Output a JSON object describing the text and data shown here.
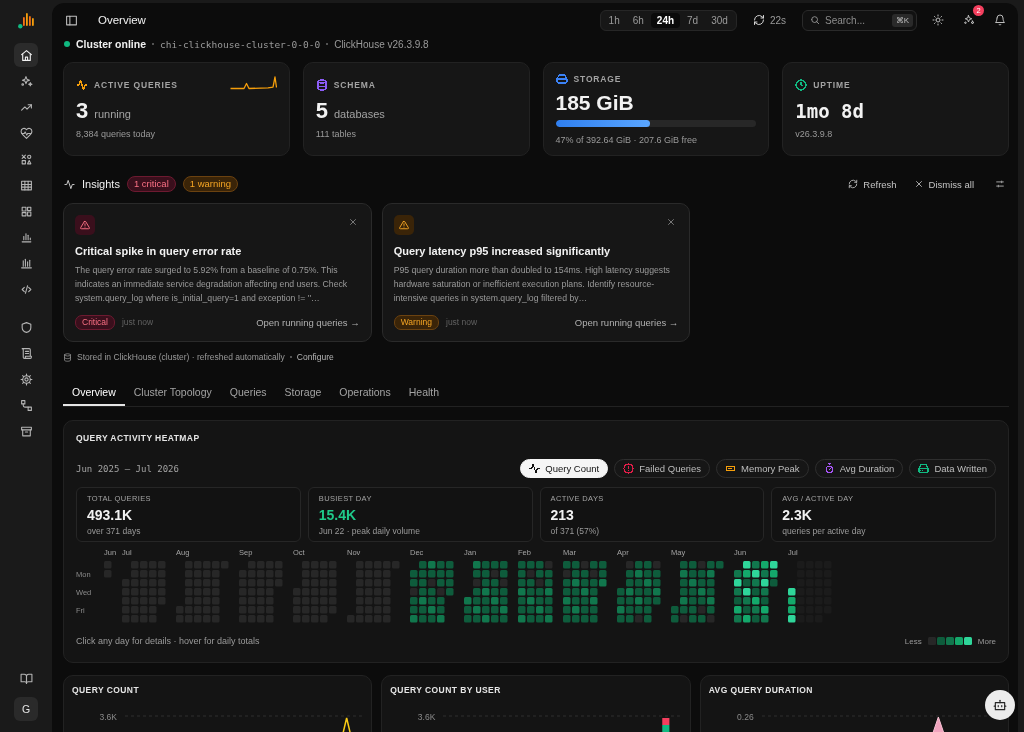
{
  "sidebar": {
    "primary": [
      {
        "selected": true
      },
      {
        "selected": false
      },
      {
        "selected": false
      },
      {
        "selected": false
      },
      {
        "selected": false
      },
      {
        "selected": false
      },
      {
        "selected": false
      },
      {
        "selected": false
      },
      {
        "selected": false
      },
      {
        "selected": false
      }
    ],
    "secondary": [
      {
        "selected": false
      },
      {
        "selected": false
      },
      {
        "selected": false
      },
      {
        "selected": false
      },
      {
        "selected": false
      }
    ],
    "footer": [
      {
        "selected": false
      }
    ],
    "avatar": "G"
  },
  "header": {
    "title": "Overview",
    "time_ranges": [
      {
        "label": "1h",
        "selected": false
      },
      {
        "label": "6h",
        "selected": false
      },
      {
        "label": "24h",
        "selected": true
      },
      {
        "label": "7d",
        "selected": false
      },
      {
        "label": "30d",
        "selected": false
      }
    ],
    "refresh_countdown": "22s",
    "search": {
      "placeholder": "Search...",
      "shortcut": "⌘K"
    },
    "assistant_badge": "2"
  },
  "cluster": {
    "online": true,
    "status": "Cluster online",
    "host": "chi-clickhouse-cluster-0-0-0",
    "version": "ClickHouse v26.3.9.8"
  },
  "stats": [
    {
      "kind": "activity",
      "color": "#f59e0b",
      "label": "ACTIVE QUERIES",
      "value": "3",
      "unit": "running",
      "detail": "8,384 queries today"
    },
    {
      "kind": "schema",
      "color": "#8b5cf6",
      "label": "SCHEMA",
      "value": "5",
      "unit": "databases",
      "detail": "111 tables"
    },
    {
      "kind": "storage",
      "color": "#3b82f6",
      "label": "STORAGE",
      "value": "185 GiB",
      "level": 0.47,
      "detail": "47% of 392.64 GiB · 207.6 GiB free"
    },
    {
      "kind": "uptime",
      "color": "#10b981",
      "label": "UPTIME",
      "value": "1mo 8d",
      "detail": "v26.3.9.8"
    }
  ],
  "insights": {
    "title": "Insights",
    "counts": [
      {
        "kind": "critical",
        "label": "1 critical"
      },
      {
        "kind": "warning",
        "label": "1 warning"
      }
    ],
    "actions": [
      {
        "kind": "refresh",
        "label": "Refresh"
      },
      {
        "kind": "dismiss",
        "label": "Dismiss all"
      },
      {
        "kind": "settings"
      }
    ],
    "cards": [
      {
        "kind": "critical",
        "title": "Critical spike in query error rate",
        "body": "The query error rate surged to 5.92% from a baseline of 0.75%. This indicates an immediate service degradation affecting end users. Check system.query_log where is_initial_query=1 and exception != ''…",
        "badge": "Critical",
        "time": "just now",
        "action": "Open running queries →"
      },
      {
        "kind": "warning",
        "title": "Query latency p95 increased significantly",
        "body": "P95 query duration more than doubled to 154ms. High latency suggests hardware saturation or inefficient execution plans. Identify resource-intensive queries in system.query_log filtered by…",
        "badge": "Warning",
        "time": "just now",
        "action": "Open running queries →"
      }
    ],
    "note": "Stored in ClickHouse (cluster) · refreshed automatically",
    "configure_link": "Configure"
  },
  "tabs": [
    {
      "label": "Overview",
      "selected": true
    },
    {
      "label": "Cluster Topology",
      "selected": false
    },
    {
      "label": "Queries",
      "selected": false
    },
    {
      "label": "Storage",
      "selected": false
    },
    {
      "label": "Operations",
      "selected": false
    },
    {
      "label": "Health",
      "selected": false
    }
  ],
  "heatmap": {
    "title": "QUERY ACTIVITY HEATMAP",
    "range": "Jun 2025 — Jul 2026",
    "metrics": [
      {
        "kind": "count",
        "label": "Query Count",
        "selected": true
      },
      {
        "kind": "failed",
        "label": "Failed Queries",
        "selected": false,
        "color": "#e11d48"
      },
      {
        "kind": "memory",
        "label": "Memory Peak",
        "selected": false,
        "color": "#f59e0b"
      },
      {
        "kind": "duration",
        "label": "Avg Duration",
        "selected": false,
        "color": "#a855f7"
      },
      {
        "kind": "written",
        "label": "Data Written",
        "selected": false,
        "color": "#10b981"
      }
    ],
    "summary": [
      {
        "label": "TOTAL QUERIES",
        "value": "493.1K",
        "detail": "over 371 days",
        "highlight": false
      },
      {
        "label": "BUSIEST DAY",
        "value": "15.4K",
        "detail": "Jun 22 · peak daily volume",
        "highlight": true
      },
      {
        "label": "ACTIVE DAYS",
        "value": "213",
        "detail": "of 371 (57%)",
        "highlight": false
      },
      {
        "label": "AVG / ACTIVE DAY",
        "value": "2.3K",
        "detail": "queries per active day",
        "highlight": false
      }
    ],
    "months": [
      "Jun",
      "Jul",
      "Aug",
      "Sep",
      "Oct",
      "Nov",
      "Dec",
      "Jan",
      "Feb",
      "Mar",
      "Apr",
      "May",
      "Jun",
      "Jul"
    ],
    "weekdays": [
      "Mon",
      "Wed",
      "Fri"
    ],
    "hint": "Click any day for details · hover for daily totals",
    "legend": {
      "low": "Less",
      "high": "More"
    }
  },
  "charts": [
    {
      "kind": "line",
      "title": "QUERY COUNT",
      "tick": "3.6K"
    },
    {
      "kind": "bar",
      "title": "QUERY COUNT BY USER",
      "tick": "3.6K"
    },
    {
      "kind": "area",
      "title": "AVG QUERY DURATION",
      "tick": "0.26"
    }
  ]
}
